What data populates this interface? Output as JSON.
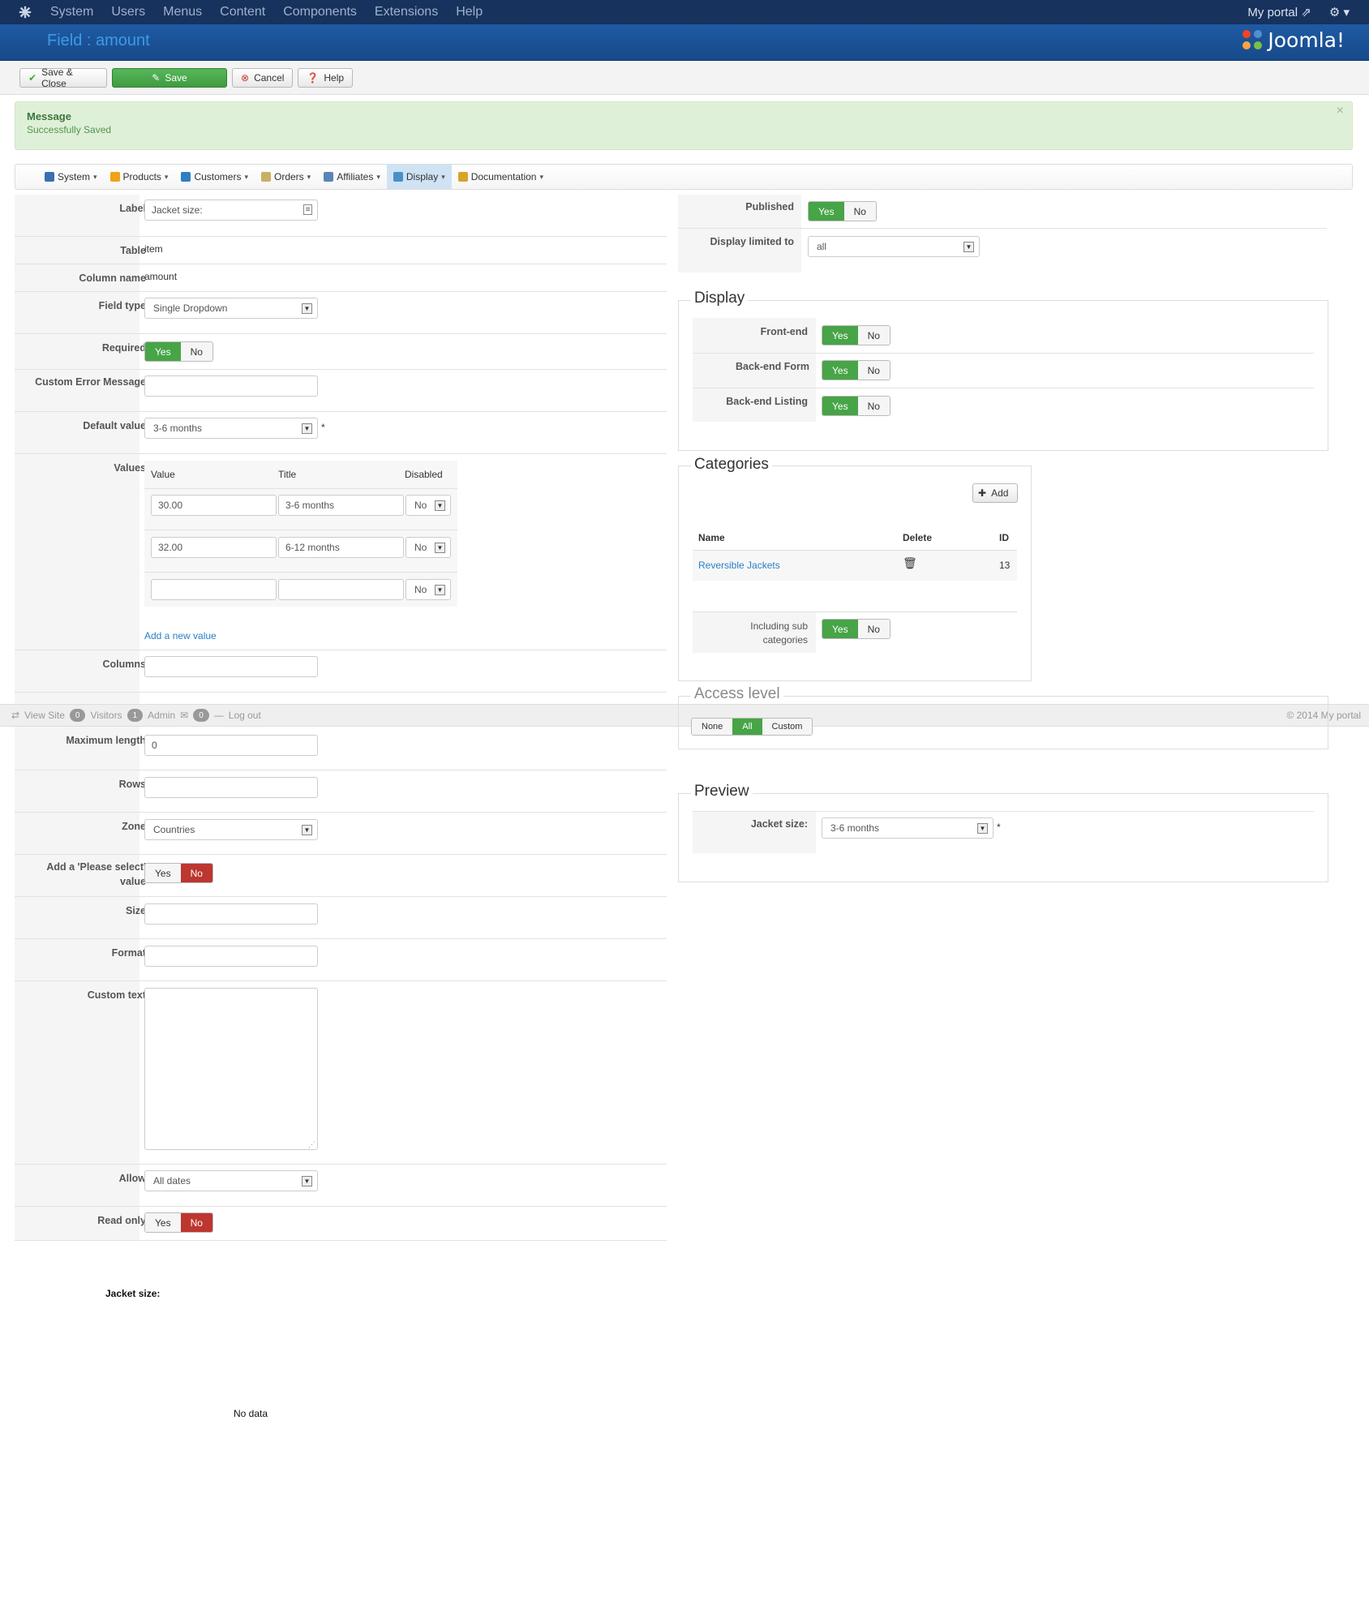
{
  "topnav": {
    "items": [
      "System",
      "Users",
      "Menus",
      "Content",
      "Components",
      "Extensions",
      "Help"
    ],
    "my_portal": "My portal"
  },
  "header": {
    "title": "Field : amount",
    "brand": "Joomla!"
  },
  "toolbar": {
    "save_close": "Save & Close",
    "save": "Save",
    "cancel": "Cancel",
    "help": "Help"
  },
  "message": {
    "heading": "Message",
    "body": "Successfully Saved",
    "close": "×"
  },
  "subnav": {
    "items": [
      {
        "label": "System",
        "color": "#3a6fb0"
      },
      {
        "label": "Products",
        "color": "#f0a21a"
      },
      {
        "label": "Customers",
        "color": "#2f7ec1"
      },
      {
        "label": "Orders",
        "color": "#c9b066"
      },
      {
        "label": "Affiliates",
        "color": "#5b85b6"
      },
      {
        "label": "Display",
        "color": "#4a90c8"
      },
      {
        "label": "Documentation",
        "color": "#d9a22a"
      }
    ]
  },
  "form": {
    "label": {
      "label": "Label",
      "value": "Jacket size:"
    },
    "table": {
      "label": "Table",
      "value": "item"
    },
    "column": {
      "label": "Column name",
      "value": "amount"
    },
    "field_type": {
      "label": "Field type",
      "value": "Single Dropdown"
    },
    "required": {
      "label": "Required",
      "yes": "Yes",
      "no": "No"
    },
    "custom_error": {
      "label": "Custom Error Message",
      "value": ""
    },
    "default_value": {
      "label": "Default value",
      "value": "3-6 months",
      "star": "*"
    },
    "values": {
      "label": "Values",
      "headers": {
        "value": "Value",
        "title": "Title",
        "disabled": "Disabled"
      },
      "rows": [
        {
          "value": "30.00",
          "title": "3-6 months",
          "disabled": "No"
        },
        {
          "value": "32.00",
          "title": "6-12 months",
          "disabled": "No"
        },
        {
          "value": "",
          "title": "",
          "disabled": "No"
        }
      ],
      "add_link": "Add a new value"
    },
    "columns": {
      "label": "Columns",
      "value": ""
    },
    "max_length": {
      "label": "Maximum length",
      "value": "0"
    },
    "rows": {
      "label": "Rows",
      "value": ""
    },
    "zone": {
      "label": "Zone",
      "value": "Countries"
    },
    "please_select": {
      "label": "Add a 'Please select' value",
      "yes": "Yes",
      "no": "No"
    },
    "size": {
      "label": "Size",
      "value": ""
    },
    "format": {
      "label": "Format",
      "value": ""
    },
    "custom_text": {
      "label": "Custom text",
      "value": ""
    },
    "allow": {
      "label": "Allow",
      "value": "All dates"
    },
    "read_only": {
      "label": "Read only",
      "yes": "Yes",
      "no": "No"
    }
  },
  "right": {
    "published": {
      "label": "Published",
      "yes": "Yes",
      "no": "No"
    },
    "display_limited": {
      "label": "Display limited to",
      "value": "all"
    },
    "display": {
      "legend": "Display",
      "front_end": {
        "label": "Front-end",
        "yes": "Yes",
        "no": "No"
      },
      "back_form": {
        "label": "Back-end Form",
        "yes": "Yes",
        "no": "No"
      },
      "back_listing": {
        "label": "Back-end Listing",
        "yes": "Yes",
        "no": "No"
      }
    },
    "categories": {
      "legend": "Categories",
      "add": "Add",
      "headers": {
        "name": "Name",
        "delete": "Delete",
        "id": "ID"
      },
      "row": {
        "name": "Reversible Jackets",
        "id": "13"
      },
      "including": {
        "label": "Including sub categories",
        "yes": "Yes",
        "no": "No"
      }
    },
    "access": {
      "legend": "Access level",
      "opts": [
        "None",
        "All",
        "Custom"
      ]
    },
    "preview": {
      "legend": "Preview",
      "label": "Jacket size:",
      "value": "3-6 months",
      "star": "*"
    }
  },
  "statusbar": {
    "view_site": "View Site",
    "visitors_count": "0",
    "visitors": "Visitors",
    "admin_count": "1",
    "admin": "Admin",
    "msg_count": "0",
    "logout": "Log out",
    "copyright": "© 2014 My portal"
  },
  "bottom": {
    "jacket_label": "Jacket size:",
    "no_data": "No data"
  },
  "colors": {
    "green": "#47a447",
    "red": "#bd362f",
    "navy": "#17325c",
    "blue": "#1f5aa3"
  }
}
